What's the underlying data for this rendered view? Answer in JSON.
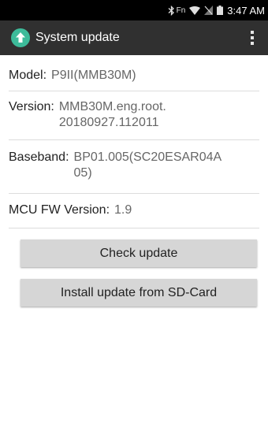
{
  "status_bar": {
    "fn_label": "Fn",
    "time": "3:47 AM",
    "icons": [
      "bluetooth-icon",
      "wifi-icon",
      "no-sim-icon",
      "battery-icon"
    ]
  },
  "app_bar": {
    "title": "System update",
    "icon": "system-update-up-arrow-icon",
    "icon_color": "#3dbb9a",
    "background": "#303030"
  },
  "info": {
    "model": {
      "label": "Model:",
      "value": "P9II(MMB30M)"
    },
    "version": {
      "label": "Version:",
      "value_line1": "MMB30M.eng.root.",
      "value_line2": "20180927.112011"
    },
    "baseband": {
      "label": "Baseband:",
      "value_line1": "BP01.005(SC20ESAR04A",
      "value_line2": "05)"
    },
    "mcu": {
      "label": "MCU FW Version:",
      "value": "1.9"
    }
  },
  "buttons": {
    "check_update": "Check update",
    "install_sd": "Install update from SD-Card"
  }
}
